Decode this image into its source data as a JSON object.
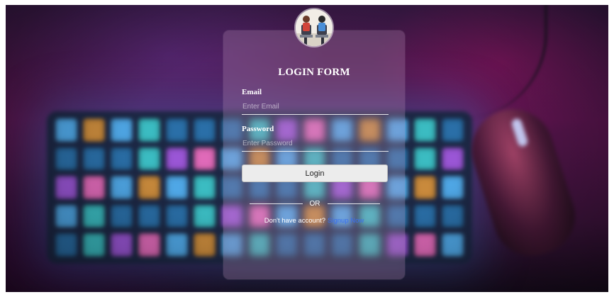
{
  "form": {
    "title": "LOGIN FORM",
    "email": {
      "label": "Email",
      "placeholder": "Enter Email",
      "value": ""
    },
    "password": {
      "label": "Password",
      "placeholder": "Enter Password",
      "value": ""
    },
    "login_label": "Login",
    "divider_text": "OR",
    "signup_prompt": "Don't have account?",
    "signup_link": "Signup Now"
  },
  "icons": {
    "avatar": "user-avatar-illustration"
  },
  "colors": {
    "link": "#3b6ff0",
    "button_bg": "#ececec",
    "text": "#ffffff"
  }
}
